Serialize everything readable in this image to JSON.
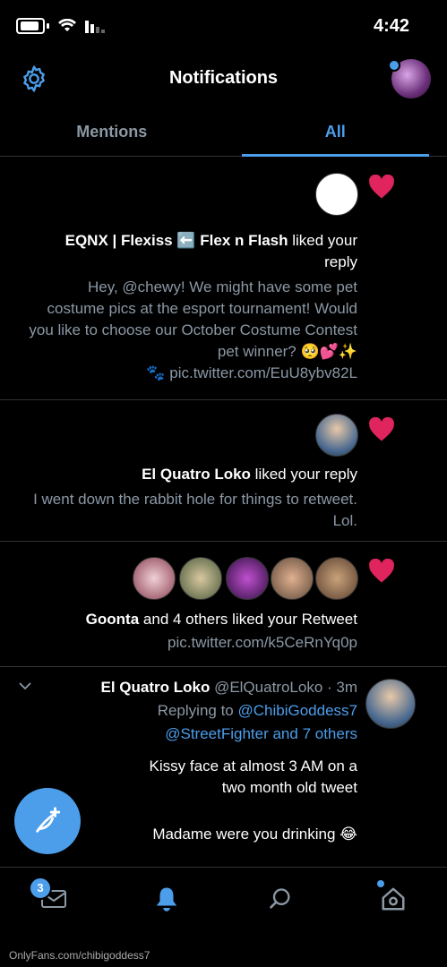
{
  "status_bar": {
    "time": "4:42"
  },
  "header": {
    "title": "Notifications"
  },
  "tabs": {
    "all": "All",
    "mentions": "Mentions"
  },
  "notifications": [
    {
      "title_bold": "EQNX | Flexiss ⬅️ Flex n Flash",
      "title_rest": "liked your reply",
      "body": "Hey, @chewy! We might have some pet costume pics at the esport tournament! Would you like to choose our October Costume Contest pet winner? 🥺💕✨",
      "link": "🐾 pic.twitter.com/EuU8ybv82L"
    },
    {
      "title_bold": "El Quatro Loko",
      "title_rest": "liked your reply",
      "body": "I went down the rabbit hole for things to retweet. Lol."
    },
    {
      "title_bold": "Goonta",
      "title_rest": "and 4 others liked your Retweet",
      "body": "pic.twitter.com/k5CeRnYq0p"
    }
  ],
  "tweet": {
    "name": "El Quatro Loko",
    "meta": "@ElQuatroLoko · 3m",
    "replying_prefix": "Replying to",
    "replying_to": "@ChibiGoddess7",
    "replying_others": "@StreetFighter and 7 others",
    "text1": "Kissy face at almost 3 AM on a two month old tweet",
    "text2": "Madame were you drinking 😂"
  },
  "bottom_bar": {
    "badge_count": "3"
  },
  "watermark": "OnlyFans.com/chibigoddess7",
  "colors": {
    "accent": "#4c9eeb",
    "heart": "#e0245e",
    "muted": "#8b98a5"
  }
}
